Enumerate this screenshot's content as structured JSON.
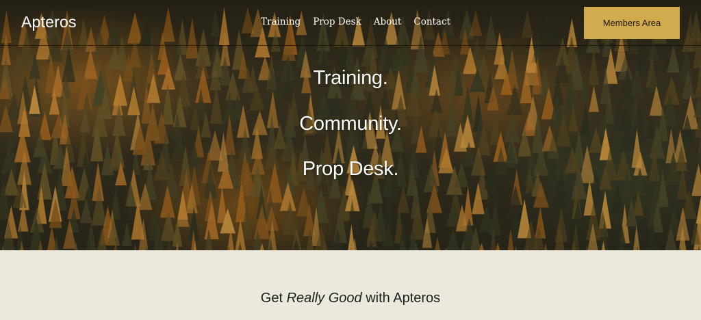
{
  "header": {
    "logo": "Apteros",
    "nav": [
      {
        "label": "Training"
      },
      {
        "label": "Prop Desk"
      },
      {
        "label": "About"
      },
      {
        "label": "Contact"
      }
    ],
    "cta_label": "Members Area"
  },
  "hero": {
    "lines": [
      "Training.",
      "Community.",
      "Prop Desk."
    ],
    "background": "forest-aerial-image"
  },
  "intro": {
    "heading_prefix": "Get",
    "heading_emphasis": "Really Good",
    "heading_suffix": "with Apteros"
  },
  "colors": {
    "cta_background": "#d3ab4f",
    "section_background": "#ebe9de",
    "hero_text": "#ffffff"
  }
}
